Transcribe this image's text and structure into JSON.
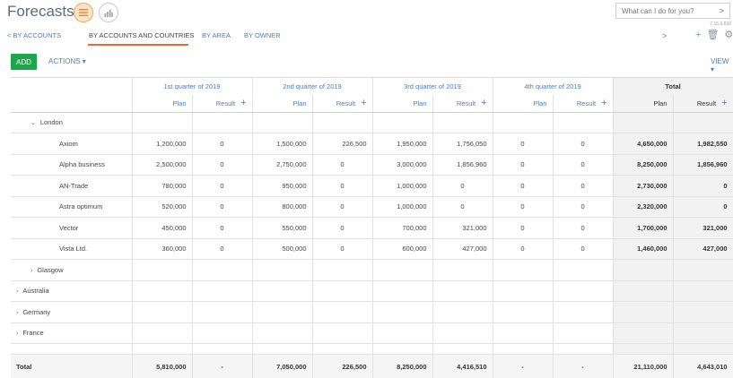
{
  "header": {
    "title": "Forecasts",
    "search_placeholder": "What can I do for you?",
    "version": "7.15.0.632"
  },
  "tabs": [
    {
      "label": "< BY ACCOUNTS"
    },
    {
      "label": "BY ACCOUNTS AND COUNTRIES"
    },
    {
      "label": "BY AREA"
    },
    {
      "label": "BY OWNER"
    }
  ],
  "toolbar": {
    "add_label": "ADD",
    "actions_label": "ACTIONS ▾",
    "view_label": "VIEW ▾"
  },
  "columns": {
    "quarters": [
      "1st quarter of 2019",
      "2nd quarter of 2019",
      "3rd quarter of 2019",
      "4th quarter of 2019"
    ],
    "total": "Total",
    "plan": "Plan",
    "result": "Result"
  },
  "rows": [
    {
      "name": "London",
      "kind": "group",
      "values": []
    },
    {
      "name": "Axiom",
      "kind": "item",
      "values": [
        "1,200,000",
        "0",
        "1,500,000",
        "226,500",
        "1,950,000",
        "1,756,050",
        "0",
        "0",
        "4,650,000",
        "1,982,550"
      ]
    },
    {
      "name": "Alpha business",
      "kind": "item",
      "values": [
        "2,500,000",
        "0",
        "2,750,000",
        "0",
        "3,000,000",
        "1,856,960",
        "0",
        "0",
        "8,250,000",
        "1,856,960"
      ]
    },
    {
      "name": "AN-Trade",
      "kind": "item",
      "values": [
        "780,000",
        "0",
        "950,000",
        "0",
        "1,000,000",
        "0",
        "0",
        "0",
        "2,730,000",
        "0"
      ]
    },
    {
      "name": "Astra optimum",
      "kind": "item",
      "values": [
        "520,000",
        "0",
        "800,000",
        "0",
        "1,000,000",
        "0",
        "0",
        "0",
        "2,320,000",
        "0"
      ]
    },
    {
      "name": "Vector",
      "kind": "item",
      "values": [
        "450,000",
        "0",
        "550,000",
        "0",
        "700,000",
        "321,000",
        "0",
        "0",
        "1,700,000",
        "321,000"
      ]
    },
    {
      "name": "Vista Ltd.",
      "kind": "item",
      "values": [
        "360,000",
        "0",
        "500,000",
        "0",
        "600,000",
        "427,000",
        "0",
        "0",
        "1,460,000",
        "427,000"
      ]
    },
    {
      "name": "Glasgow",
      "kind": "subgroup",
      "values": []
    },
    {
      "name": "Australia",
      "kind": "country",
      "values": []
    },
    {
      "name": "Germany",
      "kind": "country",
      "values": []
    },
    {
      "name": "France",
      "kind": "country",
      "values": []
    }
  ],
  "grand_total": {
    "label": "Total",
    "values": [
      "5,810,000",
      "-",
      "7,050,000",
      "226,500",
      "8,250,000",
      "4,416,510",
      "-",
      "-",
      "21,110,000",
      "4,643,010"
    ]
  }
}
